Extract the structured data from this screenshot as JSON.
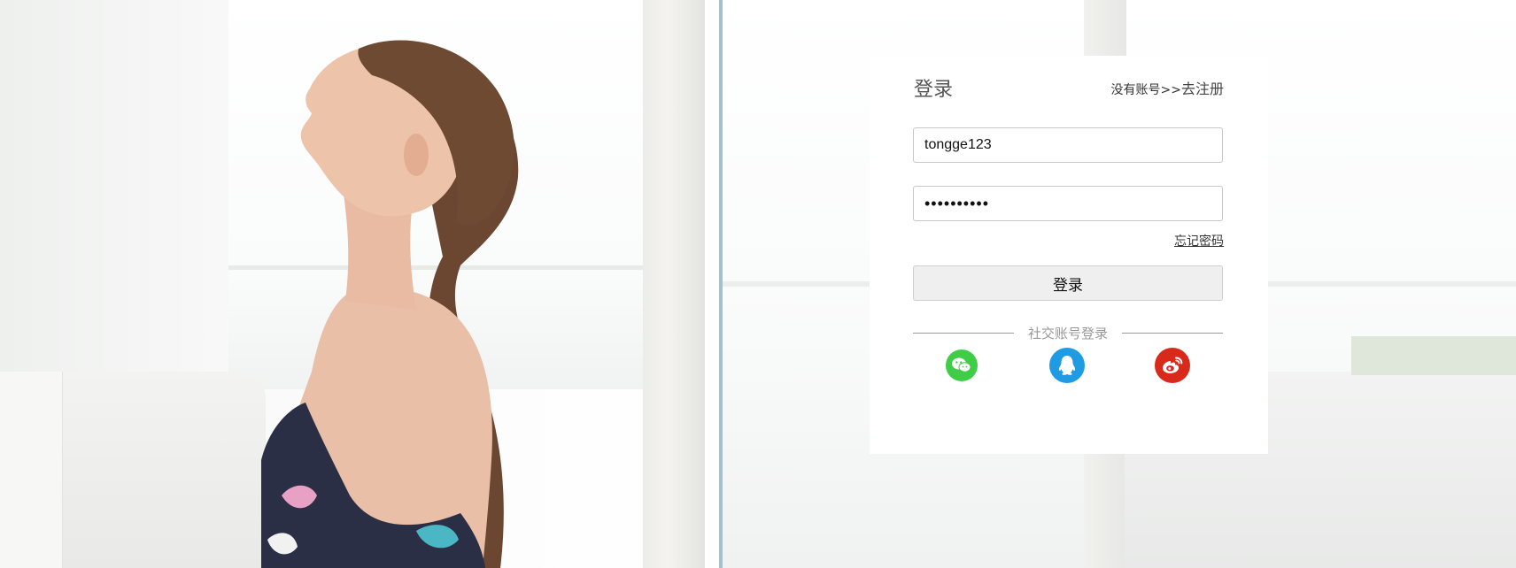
{
  "login": {
    "title": "登录",
    "register_prefix": "没有账号>>",
    "register_link": "去注册",
    "username_value": "tongge123",
    "password_value": "••••••••••",
    "forgot_label": "忘记密码",
    "submit_label": "登录",
    "social_label": "社交账号登录",
    "social": [
      {
        "name": "wechat",
        "icon": "wechat-icon",
        "color": "#3fcd47"
      },
      {
        "name": "qq",
        "icon": "qq-penguin-icon",
        "color": "#1e9be3"
      },
      {
        "name": "weibo",
        "icon": "weibo-icon",
        "color": "#d9291b"
      }
    ]
  },
  "background": {
    "scene": "woman-profile-by-window-photo"
  }
}
